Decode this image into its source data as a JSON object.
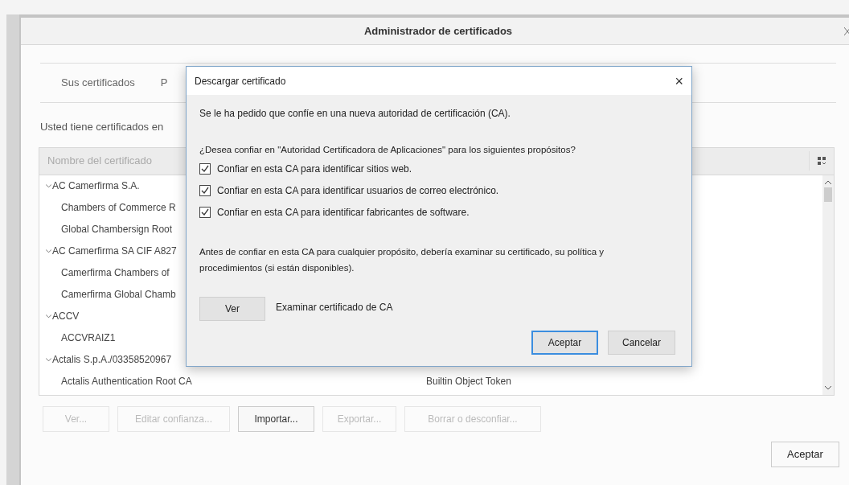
{
  "window": {
    "title": "Administrador de certificados"
  },
  "tabs": [
    {
      "label": "Sus certificados",
      "selected": false
    },
    {
      "label": "P",
      "selected": false
    }
  ],
  "intro": "Usted tiene certificados en",
  "table": {
    "columns": [
      "Nombre del certificado"
    ],
    "rows": [
      {
        "name": "AC Camerfirma S.A.",
        "expanded": true,
        "children": [
          {
            "name": "Chambers of Commerce R"
          },
          {
            "name": "Global Chambersign Root"
          }
        ]
      },
      {
        "name": "AC Camerfirma SA CIF A827",
        "expanded": true,
        "children": [
          {
            "name": "Camerfirma Chambers of"
          },
          {
            "name": "Camerfirma Global Chamb"
          }
        ]
      },
      {
        "name": "ACCV",
        "expanded": true,
        "children": [
          {
            "name": "ACCVRAIZ1"
          }
        ]
      },
      {
        "name": "Actalis S.p.A./03358520967",
        "expanded": true,
        "children": [
          {
            "name": "Actalis Authentication Root CA",
            "token": "Builtin Object Token"
          }
        ]
      }
    ]
  },
  "buttons": [
    {
      "label": "Ver...",
      "disabled": true
    },
    {
      "label": "Editar confianza...",
      "disabled": true
    },
    {
      "label": "Importar...",
      "disabled": false
    },
    {
      "label": "Exportar...",
      "disabled": true
    },
    {
      "label": "Borrar o desconfiar...",
      "disabled": true
    }
  ],
  "ok_button": "Aceptar",
  "dialog": {
    "title": "Descargar certificado",
    "close": "×",
    "message": "Se le ha pedido que confíe en una nueva autoridad de certificación (CA).",
    "question": "¿Desea confiar en \"Autoridad Certificadora de Aplicaciones\" para los siguientes propósitos?",
    "options": [
      {
        "label": "Confiar en esta CA para identificar sitios web.",
        "checked": true
      },
      {
        "label": "Confiar en esta CA para identificar usuarios de correo electrónico.",
        "checked": true
      },
      {
        "label": "Confiar en esta CA para identificar fabricantes de software.",
        "checked": true
      }
    ],
    "warning": "Antes de confiar en esta CA para cualquier propósito, debería examinar su certificado, su política y procedimientos (si están disponibles).",
    "view_button": "Ver",
    "view_label": "Examinar certificado de CA",
    "accept": "Aceptar",
    "cancel": "Cancelar"
  }
}
